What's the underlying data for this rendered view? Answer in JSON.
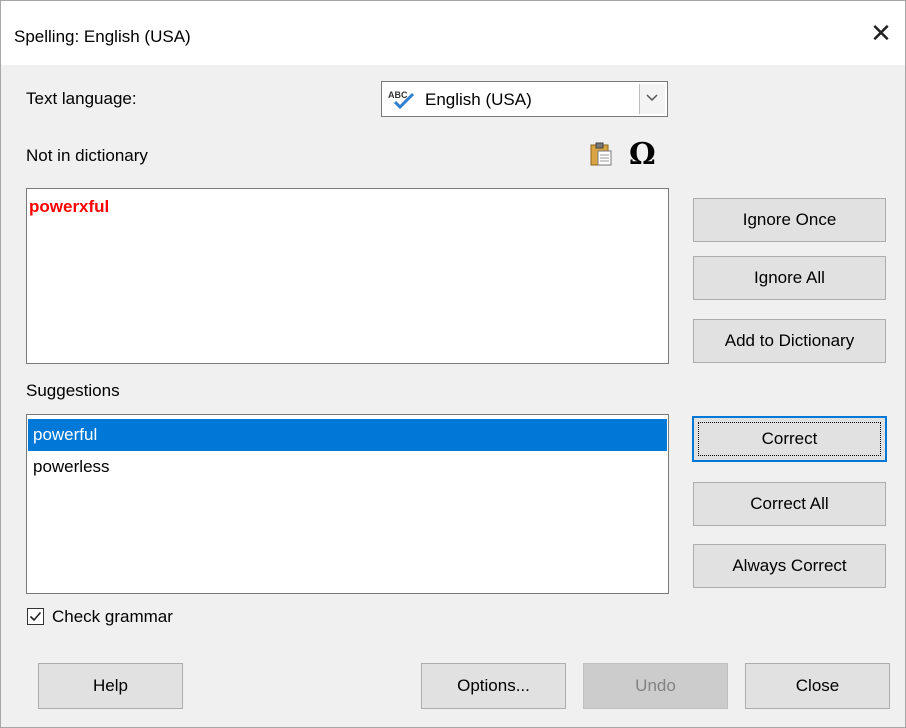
{
  "window": {
    "title": "Spelling: English (USA)"
  },
  "labels": {
    "text_language": "Text language:",
    "not_in_dictionary": "Not in dictionary",
    "suggestions": "Suggestions"
  },
  "language_select": {
    "value": "English (USA)"
  },
  "not_in_dictionary_text": "powerxful",
  "suggestions": [
    {
      "text": "powerful",
      "selected": true
    },
    {
      "text": "powerless",
      "selected": false
    }
  ],
  "side_buttons": {
    "ignore_once": "Ignore Once",
    "ignore_all": "Ignore All",
    "add_to_dictionary": "Add to Dictionary",
    "correct": "Correct",
    "correct_all": "Correct All",
    "always_correct": "Always Correct"
  },
  "check_grammar": {
    "label": "Check grammar",
    "checked": true
  },
  "bottom_buttons": {
    "help": "Help",
    "options": "Options...",
    "undo": "Undo",
    "close": "Close"
  },
  "icons": {
    "close": "close-icon",
    "spellcheck": "spellcheck-abc-icon",
    "paste": "paste-icon",
    "special_character": "special-character-icon",
    "dropdown": "chevron-down-icon",
    "checkbox_check": "checkmark-icon"
  },
  "colors": {
    "selection": "#0078d7",
    "misspelled": "#ff0000",
    "default_button_border": "#0078d7"
  }
}
